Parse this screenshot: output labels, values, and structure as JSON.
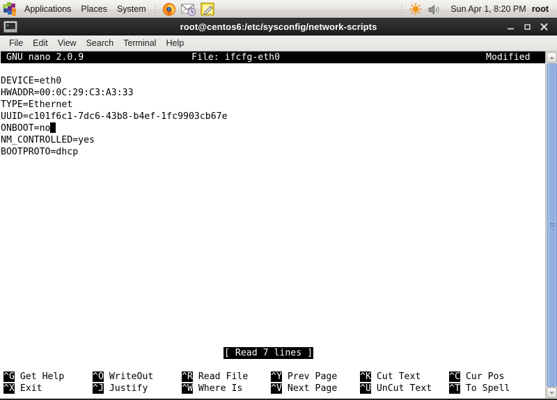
{
  "panel": {
    "logo_icon": "centos-logo-icon",
    "menus": [
      {
        "label": "Applications",
        "name": "panel-menu-applications"
      },
      {
        "label": "Places",
        "name": "panel-menu-places"
      },
      {
        "label": "System",
        "name": "panel-menu-system"
      }
    ],
    "launchers": [
      {
        "icon": "firefox-icon",
        "name": "launcher-firefox"
      },
      {
        "icon": "evolution-mail-icon",
        "name": "launcher-evolution"
      },
      {
        "icon": "notes-editor-icon",
        "name": "launcher-notes"
      }
    ],
    "tray": [
      {
        "icon": "brightness-sun-icon",
        "name": "tray-brightness"
      },
      {
        "icon": "volume-speaker-icon",
        "name": "tray-volume"
      }
    ],
    "clock": "Sun Apr  1,  8:20 PM",
    "user": "root"
  },
  "window": {
    "icon": "terminal-icon",
    "title": "root@centos6:/etc/sysconfig/network-scripts",
    "buttons": {
      "minimize": "_",
      "maximize": "□",
      "close": "✕"
    }
  },
  "menubar": [
    {
      "label": "File",
      "name": "menu-file"
    },
    {
      "label": "Edit",
      "name": "menu-edit"
    },
    {
      "label": "View",
      "name": "menu-view"
    },
    {
      "label": "Search",
      "name": "menu-search"
    },
    {
      "label": "Terminal",
      "name": "menu-terminal"
    },
    {
      "label": "Help",
      "name": "menu-help"
    }
  ],
  "nano": {
    "version_label": "GNU nano 2.0.9",
    "file_label": "File: ifcfg-eth0",
    "modified_label": "Modified",
    "content_lines": [
      "DEVICE=eth0",
      "HWADDR=00:0C:29:C3:A3:33",
      "TYPE=Ethernet",
      "UUID=c101f6c1-7dc6-43b8-b4ef-1fc9903cb67e",
      "ONBOOT=no",
      "NM_CONTROLLED=yes",
      "BOOTPROTO=dhcp"
    ],
    "cursor_line_index": 4,
    "status_message": "[ Read 7 lines ]",
    "shortcuts_row1": [
      {
        "key": "^G",
        "label": " Get Help"
      },
      {
        "key": "^O",
        "label": " WriteOut"
      },
      {
        "key": "^R",
        "label": " Read File"
      },
      {
        "key": "^Y",
        "label": " Prev Page"
      },
      {
        "key": "^K",
        "label": " Cut Text"
      },
      {
        "key": "^C",
        "label": " Cur Pos"
      }
    ],
    "shortcuts_row2": [
      {
        "key": "^X",
        "label": " Exit"
      },
      {
        "key": "^J",
        "label": " Justify"
      },
      {
        "key": "^W",
        "label": " Where Is"
      },
      {
        "key": "^V",
        "label": " Next Page"
      },
      {
        "key": "^U",
        "label": " UnCut Text"
      },
      {
        "key": "^T",
        "label": " To Spell"
      }
    ]
  },
  "scrollbar": {
    "up_arrow": "▲",
    "down_arrow": "▼"
  },
  "colors": {
    "panel_bg": "#e9e7e3",
    "titlebar_bg": "#2a2a2a",
    "terminal_bg": "#ffffff",
    "terminal_fg": "#000000",
    "scrollbar_thumb": "#97b3e4"
  }
}
